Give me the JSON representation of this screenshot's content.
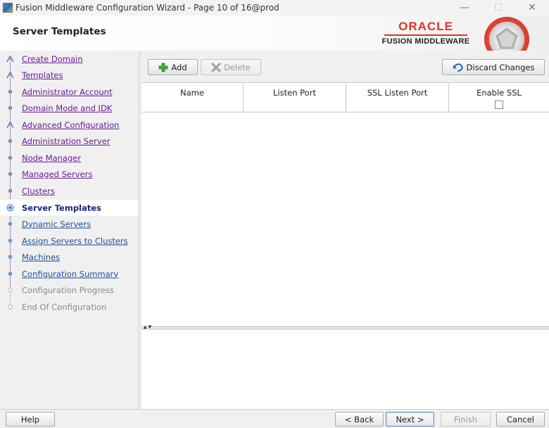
{
  "window": {
    "title": "Fusion Middleware Configuration Wizard - Page 10 of 16@prod",
    "minimize_glyph": "—",
    "maximize_glyph": "☐",
    "close_glyph": "✕"
  },
  "header": {
    "title": "Server Templates",
    "logo_word": "ORACLE",
    "logo_tagline": "FUSION MIDDLEWARE"
  },
  "nav": {
    "items": [
      {
        "label": "Create Domain",
        "state": "done"
      },
      {
        "label": "Templates",
        "state": "done"
      },
      {
        "label": "Administrator Account",
        "state": "done"
      },
      {
        "label": "Domain Mode and JDK",
        "state": "done"
      },
      {
        "label": "Advanced Configuration",
        "state": "done"
      },
      {
        "label": "Administration Server",
        "state": "done"
      },
      {
        "label": "Node Manager",
        "state": "done"
      },
      {
        "label": "Managed Servers",
        "state": "done"
      },
      {
        "label": "Clusters",
        "state": "done"
      },
      {
        "label": "Server Templates",
        "state": "current"
      },
      {
        "label": "Dynamic Servers",
        "state": "pending"
      },
      {
        "label": "Assign Servers to Clusters",
        "state": "pending"
      },
      {
        "label": "Machines",
        "state": "pending"
      },
      {
        "label": "Configuration Summary",
        "state": "pending"
      },
      {
        "label": "Configuration Progress",
        "state": "disabled"
      },
      {
        "label": "End Of Configuration",
        "state": "disabled"
      }
    ]
  },
  "toolbar": {
    "add_label": "Add",
    "delete_label": "Delete",
    "discard_label": "Discard Changes"
  },
  "table": {
    "columns": [
      "Name",
      "Listen Port",
      "SSL Listen Port",
      "Enable SSL"
    ],
    "rows": []
  },
  "footer": {
    "help_label": "Help",
    "back_label": "< Back",
    "next_label": "Next >",
    "finish_label": "Finish",
    "cancel_label": "Cancel"
  },
  "colors": {
    "visited_link": "#6a1b9a",
    "pending_link": "#1b4f9c",
    "oracle_red": "#e03224"
  }
}
